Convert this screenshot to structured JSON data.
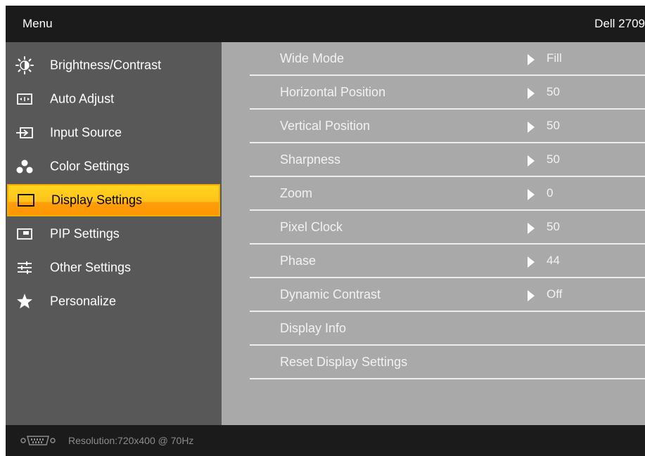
{
  "header": {
    "menu_label": "Menu",
    "model": "Dell 2709"
  },
  "sidebar": {
    "items": [
      {
        "label": "Brightness/Contrast",
        "icon": "brightness-icon"
      },
      {
        "label": "Auto Adjust",
        "icon": "auto-adjust-icon"
      },
      {
        "label": "Input Source",
        "icon": "input-source-icon"
      },
      {
        "label": "Color Settings",
        "icon": "color-settings-icon"
      },
      {
        "label": "Display Settings",
        "icon": "display-settings-icon",
        "selected": true
      },
      {
        "label": "PIP Settings",
        "icon": "pip-settings-icon"
      },
      {
        "label": "Other Settings",
        "icon": "other-settings-icon"
      },
      {
        "label": "Personalize",
        "icon": "star-icon"
      }
    ]
  },
  "main": {
    "rows": [
      {
        "label": "Wide Mode",
        "value": "Fill"
      },
      {
        "label": "Horizontal Position",
        "value": "50"
      },
      {
        "label": "Vertical Position",
        "value": "50"
      },
      {
        "label": "Sharpness",
        "value": "50"
      },
      {
        "label": "Zoom",
        "value": "0"
      },
      {
        "label": "Pixel Clock",
        "value": "50"
      },
      {
        "label": "Phase",
        "value": "44"
      },
      {
        "label": "Dynamic Contrast",
        "value": "Off"
      },
      {
        "label": "Display Info",
        "value": ""
      },
      {
        "label": "Reset Display Settings",
        "value": ""
      }
    ]
  },
  "footer": {
    "resolution_text": "Resolution:720x400 @ 70Hz",
    "connector_icon": "vga-connector-icon"
  },
  "colors": {
    "selected_top": "#ffd61f",
    "selected_bottom": "#ff9500",
    "sidebar_bg": "#585858",
    "main_bg": "#a9a9a9",
    "frame_bg": "#1b1b1b"
  }
}
